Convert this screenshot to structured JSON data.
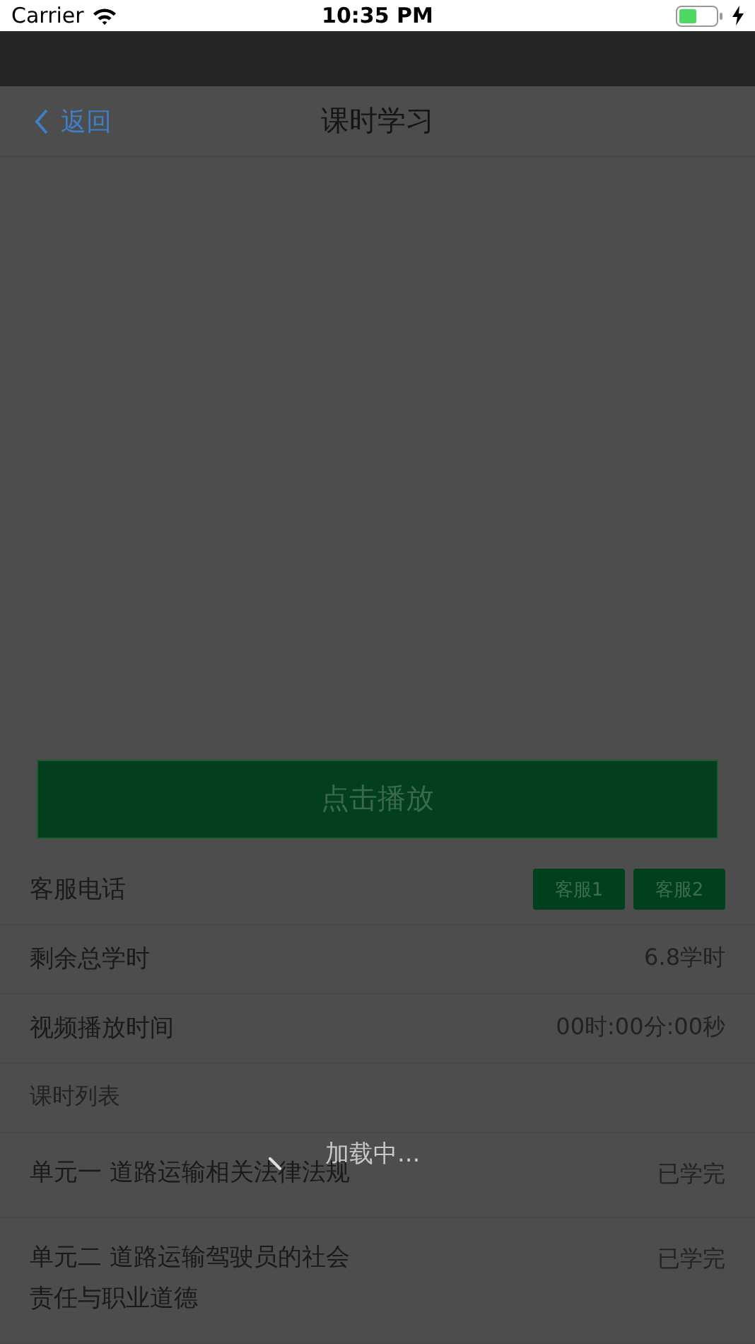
{
  "status_bar": {
    "carrier": "Carrier",
    "time": "10:35 PM"
  },
  "nav": {
    "back": "返回",
    "title": "课时学习"
  },
  "play_button": "点击播放",
  "info_rows": [
    {
      "kind": "buttons",
      "label": "客服电话",
      "buttons": [
        "客服1",
        "客服2"
      ]
    },
    {
      "kind": "value",
      "label": "剩余总学时",
      "value": "6.8学时"
    },
    {
      "kind": "value",
      "label": "视频播放时间",
      "value": "00时:00分:00秒"
    }
  ],
  "lesson_list": {
    "header": "课时列表",
    "items": [
      {
        "title": "单元一 道路运输相关法律法规",
        "status": "已学完"
      },
      {
        "title": "单元二 道路运输驾驶员的社会责任与职业道德",
        "status": "已学完"
      }
    ]
  },
  "loading": {
    "text": "加载中..."
  }
}
